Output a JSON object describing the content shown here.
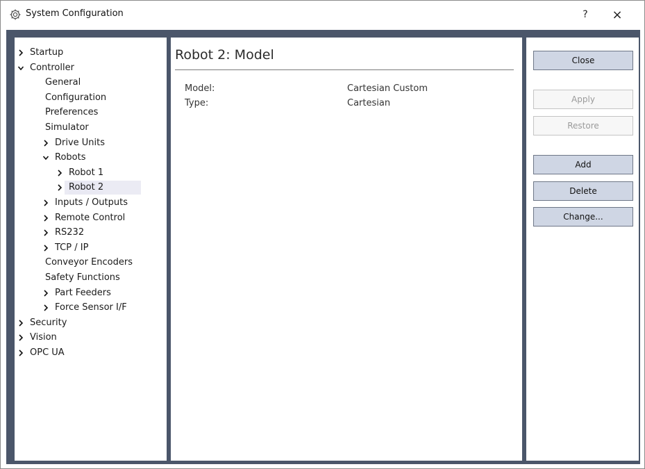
{
  "window": {
    "title": "System Configuration",
    "help_label": "?",
    "close_label": "×"
  },
  "tree": {
    "items": [
      {
        "label": "Startup",
        "arrow": "›"
      },
      {
        "label": "Controller",
        "arrow": "⌄"
      },
      {
        "label": "General"
      },
      {
        "label": "Configuration"
      },
      {
        "label": "Preferences"
      },
      {
        "label": "Simulator"
      },
      {
        "label": "Drive Units",
        "arrow": "›"
      },
      {
        "label": "Robots",
        "arrow": "⌄"
      },
      {
        "label": "Robot 1",
        "arrow": "›"
      },
      {
        "label": "Robot 2",
        "arrow": "›",
        "selected": true
      },
      {
        "label": "Inputs / Outputs",
        "arrow": "›"
      },
      {
        "label": "Remote Control",
        "arrow": "›"
      },
      {
        "label": "RS232",
        "arrow": "›"
      },
      {
        "label": "TCP / IP",
        "arrow": "›"
      },
      {
        "label": "Conveyor Encoders"
      },
      {
        "label": "Safety Functions"
      },
      {
        "label": "Part Feeders",
        "arrow": "›"
      },
      {
        "label": "Force Sensor I/F",
        "arrow": "›"
      },
      {
        "label": "Security",
        "arrow": "›"
      },
      {
        "label": "Vision",
        "arrow": "›"
      },
      {
        "label": "OPC UA",
        "arrow": "›"
      }
    ]
  },
  "content": {
    "title": "Robot 2: Model",
    "properties": [
      {
        "label": "Model:",
        "value": "Cartesian Custom"
      },
      {
        "label": "Type:",
        "value": "Cartesian"
      }
    ]
  },
  "buttons": {
    "close": "Close",
    "apply": "Apply",
    "restore": "Restore",
    "add": "Add",
    "delete": "Delete",
    "change": "Change..."
  },
  "colors": {
    "frame": "#4b566a",
    "button_bg": "#cfd6e4",
    "selection": "#ebebf4"
  }
}
